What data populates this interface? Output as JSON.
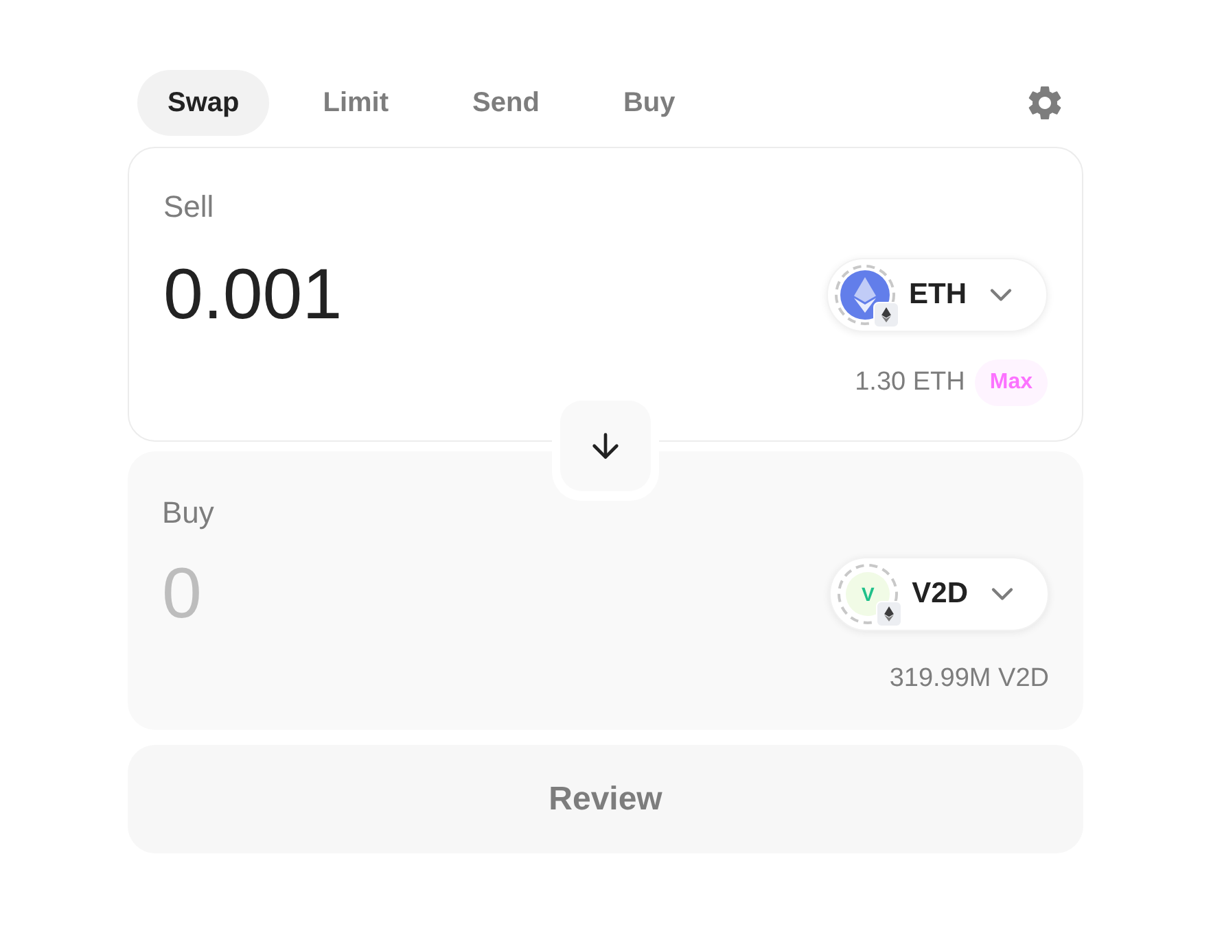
{
  "tabs": [
    {
      "label": "Swap",
      "selected": true
    },
    {
      "label": "Limit",
      "selected": false
    },
    {
      "label": "Send",
      "selected": false
    },
    {
      "label": "Buy",
      "selected": false
    }
  ],
  "sell": {
    "label": "Sell",
    "value": "0.001",
    "token": {
      "symbol": "ETH",
      "logo": {
        "kind": "eth"
      }
    },
    "balance": "1.30 ETH",
    "max_label": "Max"
  },
  "buy": {
    "label": "Buy",
    "placeholder": "0",
    "token": {
      "symbol": "V2D",
      "logo": {
        "kind": "letter",
        "letter": "V"
      }
    },
    "balance": "319.99M V2D"
  },
  "review_button": {
    "label": "Review",
    "disabled": true
  }
}
